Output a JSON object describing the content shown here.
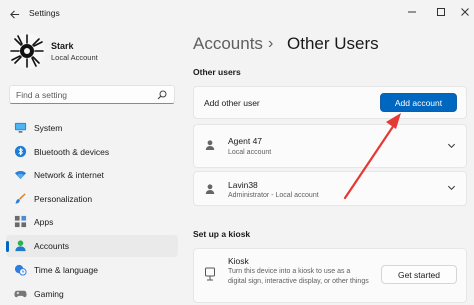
{
  "window": {
    "app_title": "Settings",
    "accent_color": "#0067c0",
    "annotation_arrow_color": "#e53935"
  },
  "profile": {
    "name": "Stark",
    "account_type": "Local Account"
  },
  "search": {
    "placeholder": "Find a setting"
  },
  "sidebar": {
    "items": [
      {
        "label": "System",
        "icon": "monitor-icon"
      },
      {
        "label": "Bluetooth & devices",
        "icon": "bluetooth-icon"
      },
      {
        "label": "Network & internet",
        "icon": "wifi-icon"
      },
      {
        "label": "Personalization",
        "icon": "brush-icon"
      },
      {
        "label": "Apps",
        "icon": "apps-icon"
      },
      {
        "label": "Accounts",
        "icon": "person-icon",
        "selected": true
      },
      {
        "label": "Time & language",
        "icon": "clock-globe-icon"
      },
      {
        "label": "Gaming",
        "icon": "gamepad-icon"
      }
    ]
  },
  "breadcrumb": {
    "root": "Accounts",
    "separator": "›",
    "current": "Other Users"
  },
  "other_users": {
    "section_title": "Other users",
    "add_label": "Add other user",
    "add_button": "Add account",
    "users": [
      {
        "name": "Agent 47",
        "detail": "Local account"
      },
      {
        "name": "Lavin38",
        "detail": "Administrator - Local account"
      }
    ]
  },
  "kiosk": {
    "section_title": "Set up a kiosk",
    "title": "Kiosk",
    "description": "Turn this device into a kiosk to use as a digital sign, interactive display, or other things",
    "button": "Get started"
  }
}
